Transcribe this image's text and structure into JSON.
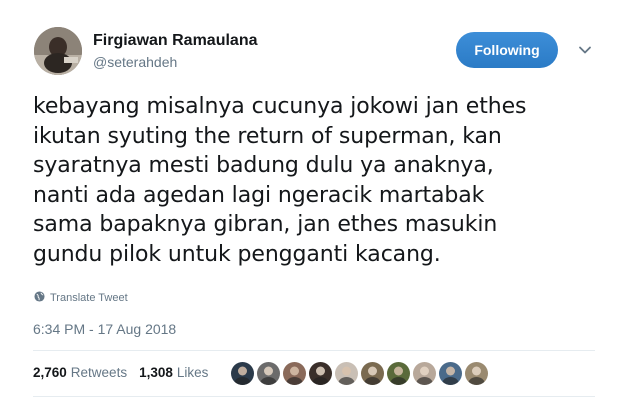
{
  "author": {
    "display_name": "Firgiawan Ramaulana",
    "handle": "@seterahdeh"
  },
  "follow_button": {
    "label": "Following"
  },
  "tweet": {
    "text": "kebayang misalnya cucunya jokowi jan ethes\nikutan syuting the return of superman, kan\nsyaratnya mesti badung dulu ya anaknya,\nnanti ada agedan lagi ngeracik martabak\nsama bapaknya gibran, jan ethes masukin\ngundu pilok untuk pengganti kacang.",
    "translate_label": "Translate Tweet",
    "timestamp": "6:34 PM - 17 Aug 2018"
  },
  "stats": {
    "retweets_count": "2,760",
    "retweets_label": "Retweets",
    "likes_count": "1,308",
    "likes_label": "Likes"
  },
  "liker_avatars": [
    {
      "color": "#2b3a4a"
    },
    {
      "color": "#6b6b6b"
    },
    {
      "color": "#8a6a5a"
    },
    {
      "color": "#3a2f2a"
    },
    {
      "color": "#c9bfb5"
    },
    {
      "color": "#7a6a50"
    },
    {
      "color": "#5a6a3a"
    },
    {
      "color": "#b8a89a"
    },
    {
      "color": "#4a6a8a"
    },
    {
      "color": "#9a8a70"
    }
  ],
  "colors": {
    "accent": "#1da1f2",
    "follow_bg": "#2b7bc6",
    "muted_text": "#657786",
    "primary_text": "#14171a",
    "divider": "#e6ecf0"
  },
  "icons": {
    "caret": "chevron-down-icon",
    "globe": "globe-icon"
  }
}
